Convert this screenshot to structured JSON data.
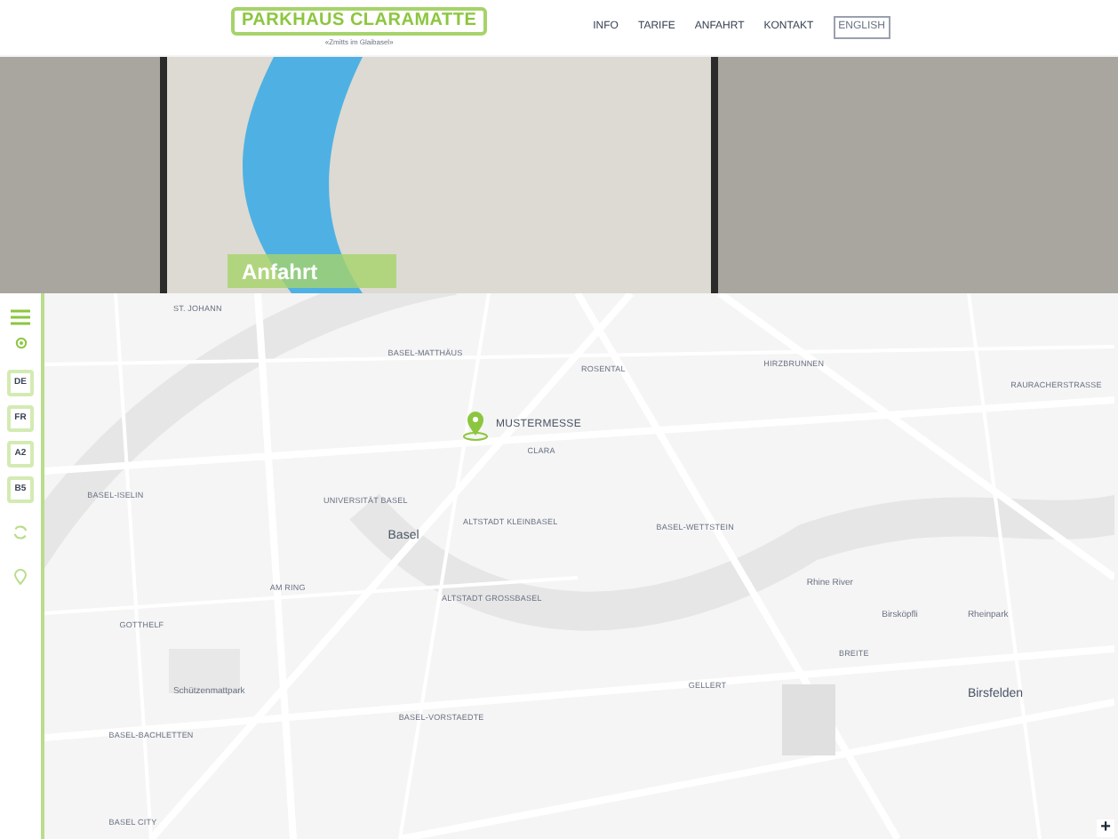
{
  "header": {
    "logo": "PARKHAUS CLARAMATTE",
    "tagline": "«Zmitts im Glaibasel»",
    "nav": [
      {
        "label": "INFO",
        "kind": "link"
      },
      {
        "label": "TARIFE",
        "kind": "link"
      },
      {
        "label": "ANFAHRT",
        "kind": "link"
      },
      {
        "label": "KONTAKT",
        "kind": "link"
      },
      {
        "label": "ENGLISH",
        "kind": "language"
      }
    ]
  },
  "hero": {
    "title": "Anfahrt"
  },
  "sidebar": {
    "buttons": [
      "DE",
      "FR",
      "A2",
      "B5"
    ]
  },
  "map": {
    "pin_label": "MUSTERMESSE",
    "zoom_in": "+",
    "labels": [
      {
        "text": "ST. JOHANN",
        "kind": "district"
      },
      {
        "text": "BASEL-MATTHÄUS",
        "kind": "district"
      },
      {
        "text": "ROSENTAL",
        "kind": "district"
      },
      {
        "text": "HIRZBRUNNEN",
        "kind": "district"
      },
      {
        "text": "RAURACHERSTRASSE",
        "kind": "district"
      },
      {
        "text": "CLARA",
        "kind": "district"
      },
      {
        "text": "UNIVERSITÄT BASEL",
        "kind": "district"
      },
      {
        "text": "Basel",
        "kind": "city"
      },
      {
        "text": "ALTSTADT KLEINBASEL",
        "kind": "district"
      },
      {
        "text": "BASEL-WETTSTEIN",
        "kind": "district"
      },
      {
        "text": "Rhine River",
        "kind": "water"
      },
      {
        "text": "Birsköpfli",
        "kind": "place"
      },
      {
        "text": "Rheinpark",
        "kind": "place"
      },
      {
        "text": "BASEL-ISELIN",
        "kind": "district"
      },
      {
        "text": "AM RING",
        "kind": "district"
      },
      {
        "text": "ALTSTADT GROSSBASEL",
        "kind": "district"
      },
      {
        "text": "GOTTHELF",
        "kind": "district"
      },
      {
        "text": "Schützenmattpark",
        "kind": "place"
      },
      {
        "text": "GELLERT",
        "kind": "district"
      },
      {
        "text": "BREITE",
        "kind": "district"
      },
      {
        "text": "Birsfelden",
        "kind": "city"
      },
      {
        "text": "BASEL-VORSTAEDTE",
        "kind": "district"
      },
      {
        "text": "BASEL-BACHLETTEN",
        "kind": "district"
      },
      {
        "text": "BASEL CITY",
        "kind": "district"
      }
    ]
  }
}
